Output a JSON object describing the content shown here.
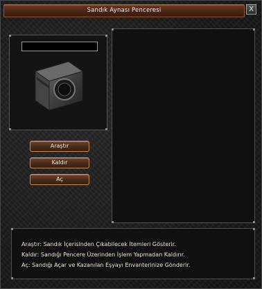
{
  "window": {
    "title": "Sandık Aynası Penceresi",
    "close_label": "X"
  },
  "buttons": {
    "search": "Araştır",
    "remove": "Kaldır",
    "open": "Aç"
  },
  "item_name_field": {
    "value": ""
  },
  "info": {
    "lines": [
      "Araştır: Sandık İçerisinden Çıkabilecek İtemleri Gösterir.",
      "Kaldır: Sandığı Pencere Üzerinden İşlem Yapmadan Kaldırır.",
      "Aç: Sandığı Açar ve Kazanılan Eşyayı Envanterinize Gönderir."
    ]
  },
  "icons": {
    "chest": "chest-icon",
    "close": "close-icon"
  }
}
